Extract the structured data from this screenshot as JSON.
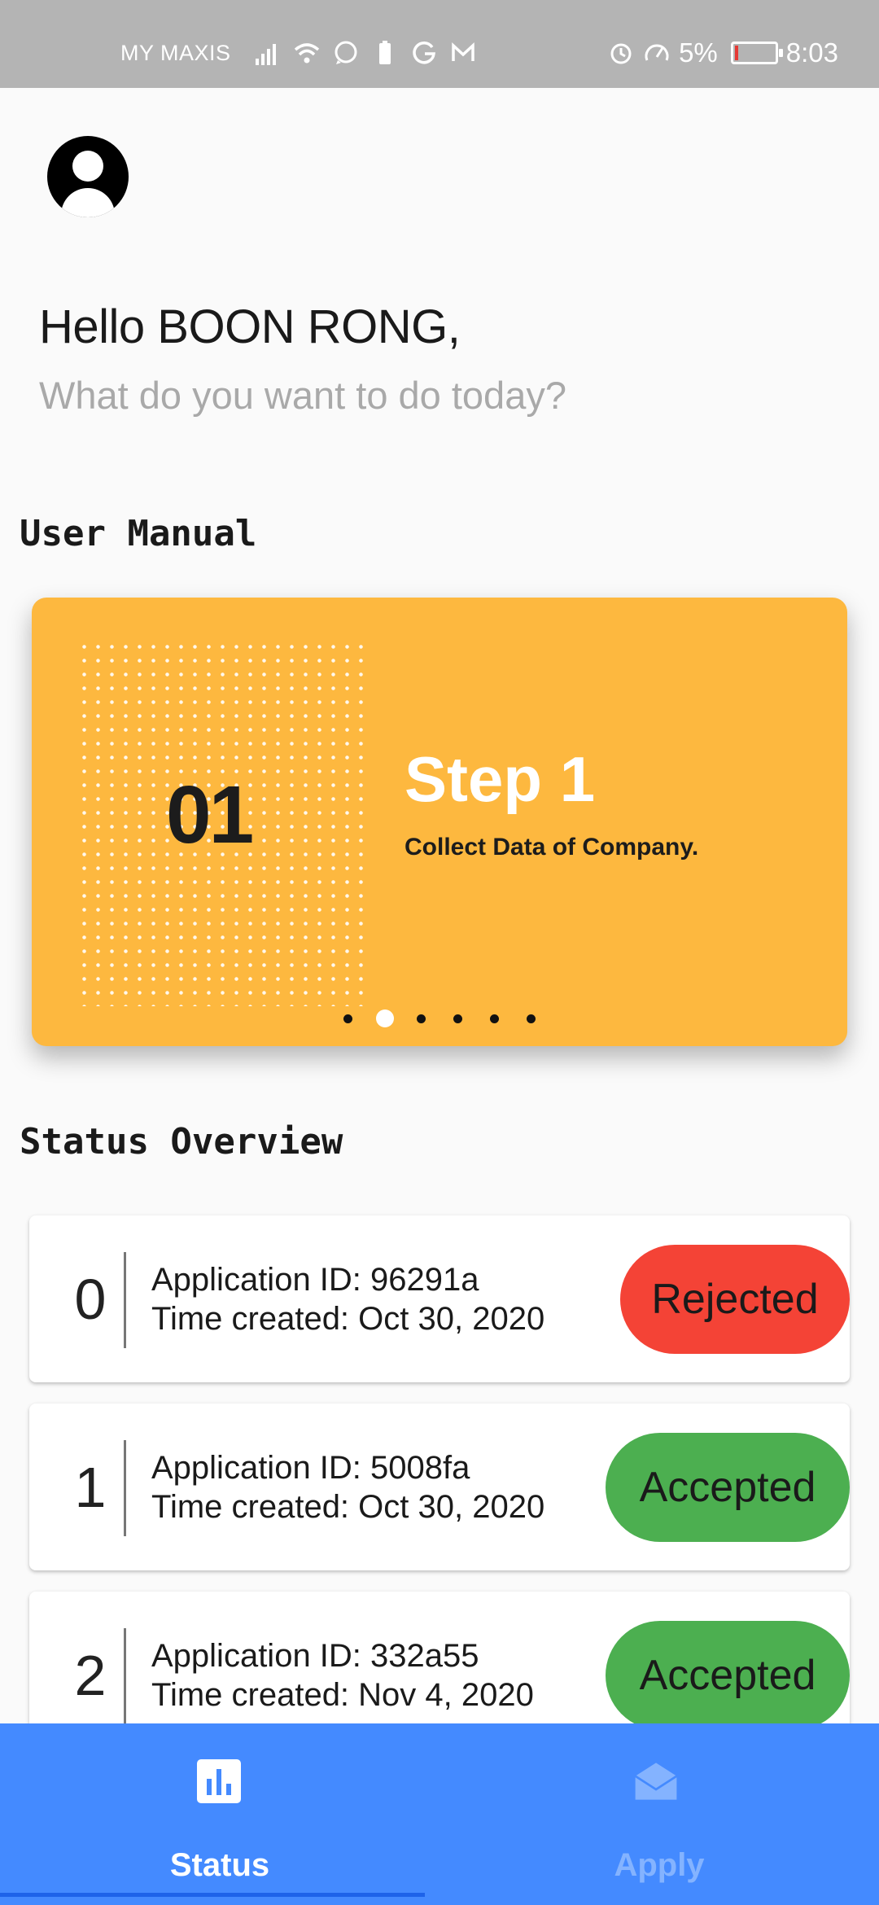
{
  "status_bar": {
    "carrier": "MY MAXIS",
    "battery_percent": "5%",
    "battery_level": 0.05,
    "time": "8:03",
    "left_icons": [
      "signal-icon",
      "wifi-icon",
      "whatsapp-icon",
      "battery-saver-icon",
      "grammarly-icon",
      "gmail-icon"
    ],
    "right_icons": [
      "alarm-icon",
      "speed-icon"
    ]
  },
  "header": {
    "avatar_icon": "account-circle-icon",
    "greeting": "Hello BOON RONG,",
    "question": "What do you want to do today?"
  },
  "user_manual": {
    "section_title": "User Manual",
    "slide": {
      "number": "01",
      "title": "Step 1",
      "description": "Collect Data of Company."
    },
    "pager": {
      "count": 6,
      "active_index": 1
    },
    "card_color": "#fdb83f"
  },
  "status_overview": {
    "section_title": "Status Overview",
    "applications": [
      {
        "index": "0",
        "id_line": "Application ID: 96291a",
        "time_line": "Time created: Oct 30, 2020",
        "status": "Rejected"
      },
      {
        "index": "1",
        "id_line": "Application ID: 5008fa",
        "time_line": "Time created: Oct 30, 2020",
        "status": "Accepted"
      },
      {
        "index": "2",
        "id_line": "Application ID: 332a55",
        "time_line": "Time created: Nov 4, 2020",
        "status": "Accepted"
      }
    ],
    "colors": {
      "rejected": "#f44336",
      "accepted": "#4caf50"
    }
  },
  "bottom_nav": {
    "background": "#448aff",
    "items": [
      {
        "label": "Status",
        "icon": "bar-chart-icon",
        "selected": true
      },
      {
        "label": "Apply",
        "icon": "drafts-envelope-icon",
        "selected": false
      }
    ]
  }
}
